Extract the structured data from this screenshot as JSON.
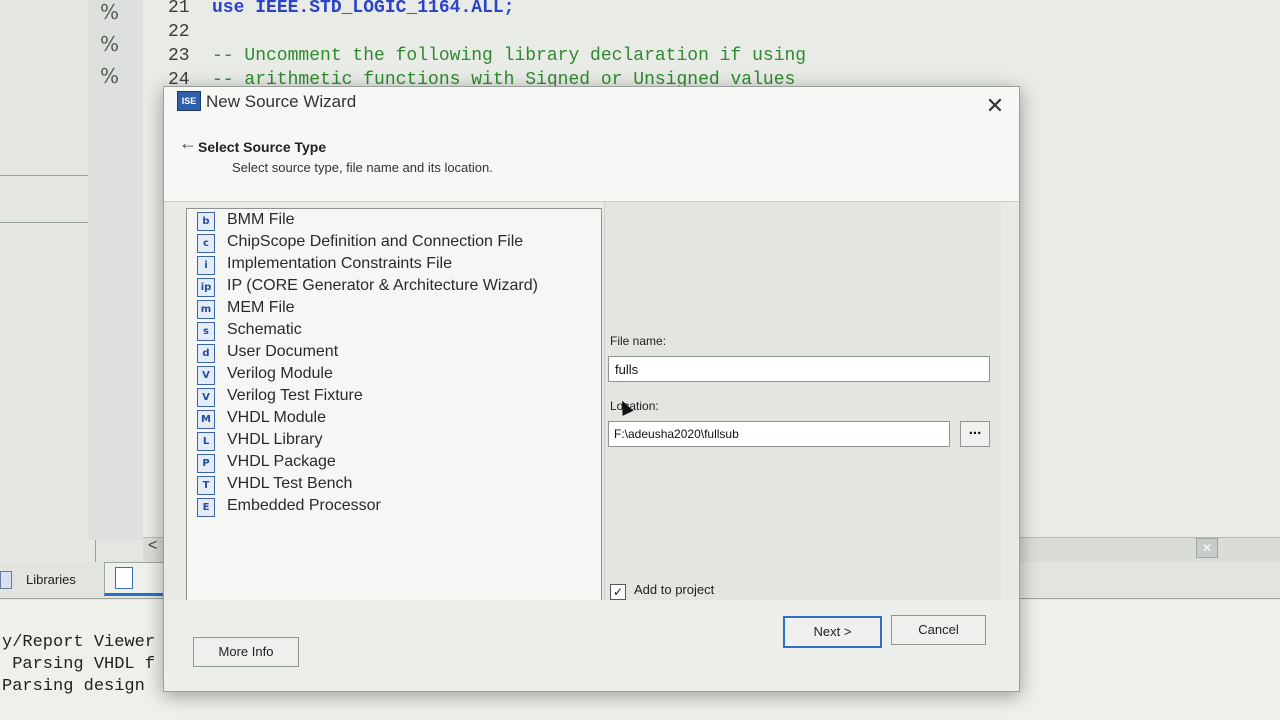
{
  "editor": {
    "lines": [
      {
        "num": "21",
        "parts": [
          {
            "t": "use ",
            "c": "kw"
          },
          {
            "t": "IEEE.STD_LOGIC_1164.",
            "c": "kw"
          },
          {
            "t": "ALL;",
            "c": "kw"
          }
        ]
      },
      {
        "num": "22",
        "parts": []
      },
      {
        "num": "23",
        "parts": [
          {
            "t": "-- Uncomment the following library declaration if using",
            "c": "cm"
          }
        ]
      },
      {
        "num": "24",
        "parts": [
          {
            "t": "-- arithmetic functions with Signed or Unsigned values",
            "c": "cm"
          }
        ]
      }
    ],
    "gutter_icons": [
      "%",
      "%",
      "%"
    ]
  },
  "bottom_tabs": {
    "libraries": "Libraries"
  },
  "console": {
    "lines": [
      "y/Report Viewer",
      " Parsing VHDL f",
      "Parsing design"
    ]
  },
  "dialog": {
    "title": "New Source Wizard",
    "app_icon": "ISE",
    "header": {
      "title": "Select Source Type",
      "subtitle": "Select source type, file name and its location."
    },
    "source_types": [
      {
        "label": "BMM File",
        "icon": "b"
      },
      {
        "label": "ChipScope Definition and Connection File",
        "icon": "c"
      },
      {
        "label": "Implementation Constraints File",
        "icon": "i"
      },
      {
        "label": "IP (CORE Generator & Architecture Wizard)",
        "icon": "ip"
      },
      {
        "label": "MEM File",
        "icon": "m"
      },
      {
        "label": "Schematic",
        "icon": "s"
      },
      {
        "label": "User Document",
        "icon": "d"
      },
      {
        "label": "Verilog Module",
        "icon": "V"
      },
      {
        "label": "Verilog Test Fixture",
        "icon": "V"
      },
      {
        "label": "VHDL Module",
        "icon": "M"
      },
      {
        "label": "VHDL Library",
        "icon": "L"
      },
      {
        "label": "VHDL Package",
        "icon": "P"
      },
      {
        "label": "VHDL Test Bench",
        "icon": "T"
      },
      {
        "label": "Embedded Processor",
        "icon": "E"
      }
    ],
    "file_name_label": "File name:",
    "file_name_value": "fulls",
    "location_label": "Location:",
    "location_value": "F:\\adeusha2020\\fullsub",
    "browse_label": "...",
    "add_to_project_label": "Add to project",
    "add_to_project_checked": true,
    "buttons": {
      "more_info": "More Info",
      "next": "Next >",
      "cancel": "Cancel"
    },
    "close_glyph": "✕",
    "back_glyph": "←"
  }
}
